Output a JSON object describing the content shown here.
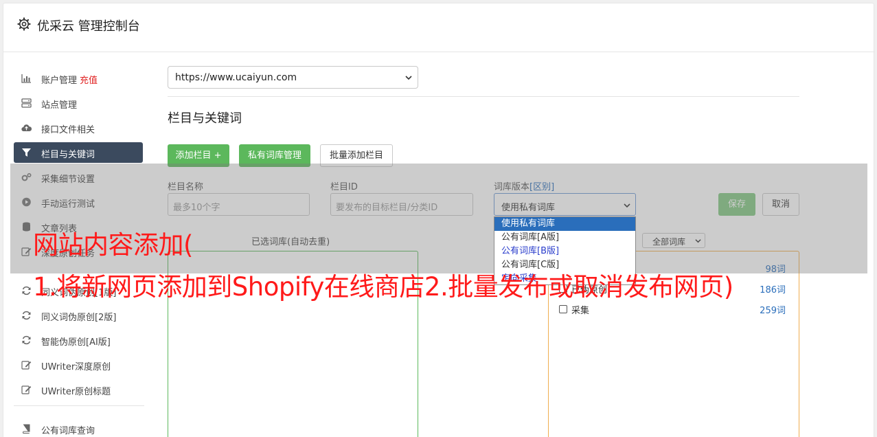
{
  "header": {
    "title": "优采云 管理控制台"
  },
  "sidebar": {
    "items": [
      {
        "label": "账户管理",
        "badge": "充值",
        "icon": "bar-chart-icon"
      },
      {
        "label": "站点管理",
        "icon": "server-icon"
      },
      {
        "label": "接口文件相关",
        "icon": "cloud-upload-icon"
      },
      {
        "label": "栏目与关键词",
        "icon": "filter-icon",
        "active": true
      },
      {
        "label": "采集细节设置",
        "icon": "cogs-icon"
      },
      {
        "label": "手动运行测试",
        "icon": "play-circle-icon"
      },
      {
        "label": "文章列表",
        "icon": "database-icon"
      },
      {
        "label": "深度原创任务",
        "icon": "edit-icon"
      },
      {
        "label": "同义词伪原创[1版]",
        "icon": "refresh-icon"
      },
      {
        "label": "同义词伪原创[2版]",
        "icon": "refresh-icon"
      },
      {
        "label": "智能伪原创[AI版]",
        "icon": "refresh-icon"
      },
      {
        "label": "UWriter深度原创",
        "icon": "edit-icon"
      },
      {
        "label": "UWriter原创标题",
        "icon": "edit-icon"
      },
      {
        "label": "公有词库查询",
        "icon": "book-icon"
      }
    ]
  },
  "site_select": {
    "value": "https://www.ucaiyun.com"
  },
  "section_title": "栏目与关键词",
  "toolbar": {
    "add_column": "添加栏目 +",
    "private_lib": "私有词库管理",
    "batch_add": "批量添加栏目"
  },
  "form": {
    "column_name_label": "栏目名称",
    "column_name_placeholder": "最多10个字",
    "column_id_label": "栏目ID",
    "column_id_placeholder": "要发布的目标栏目/分类ID",
    "lib_version_label": "词库版本",
    "lib_version_hint": "[区别]",
    "lib_version_value": "使用私有词库",
    "save": "保存",
    "cancel": "取消"
  },
  "lib_dropdown": {
    "options": [
      "使用私有词库",
      "公有词库[A版]",
      "公有词库[B版]",
      "公有词库[C版]",
      "定向采集"
    ]
  },
  "libraries": {
    "selected_title": "已选词库(自动去重)",
    "filter_value": "全部词库",
    "rows": [
      {
        "name": "",
        "count": "98词"
      },
      {
        "name": "已伪原创",
        "count": "186词"
      },
      {
        "name": "采集",
        "count": "259词"
      }
    ]
  },
  "watermark": {
    "line1": "网站内容添加(",
    "line2": "1.将新网页添加到Shopify在线商店2.批量发布或取消发布网页)"
  }
}
